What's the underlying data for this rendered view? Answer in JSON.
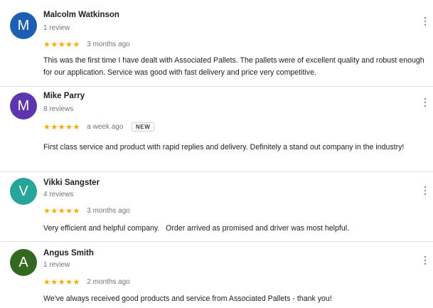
{
  "reviews": [
    {
      "avatar_letter": "M",
      "avatar_color": "#1a5fb4",
      "name": "Malcolm Watkinson",
      "review_count": "1 review",
      "stars": "★★★★★",
      "rating": 5,
      "date": "3 months ago",
      "text": "This was the first time I have dealt with Associated Pallets. The pallets were of excellent quality and robust enough for our application. Service was good with fast delivery and price very competitive."
    },
    {
      "avatar_letter": "M",
      "avatar_color": "#5e35b1",
      "name": "Mike Parry",
      "review_count": "8 reviews",
      "stars": "★★★★★",
      "rating": 5,
      "date": "a week ago",
      "badge": "NEW",
      "text": "First class service and product with rapid replies and delivery. Definitely a stand out company in the industry!"
    },
    {
      "avatar_letter": "V",
      "avatar_color": "#26a69a",
      "name": "Vikki Sangster",
      "review_count": "4 reviews",
      "stars": "★★★★★",
      "rating": 5,
      "date": "3 months ago",
      "text": "Very efficient and helpful company.   Order arrived as promised and driver was most helpful."
    },
    {
      "avatar_letter": "A",
      "avatar_color": "#33691e",
      "name": "Angus Smith",
      "review_count": "1 review",
      "stars": "★★★★★",
      "rating": 5,
      "date": "2 months ago",
      "text": "We've always received good products and service from Associated Pallets - thank you!"
    }
  ],
  "more_icon": "more-vert-icon"
}
